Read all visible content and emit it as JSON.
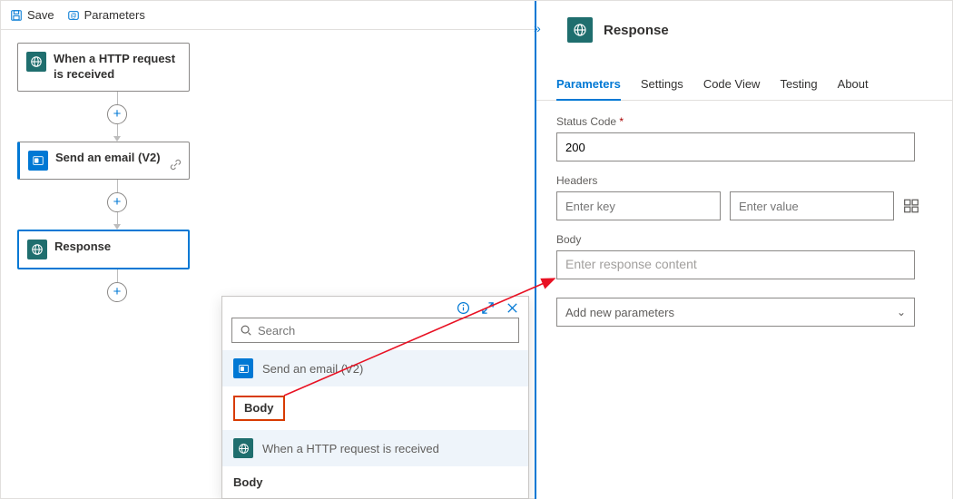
{
  "toolbar": {
    "save": "Save",
    "parameters": "Parameters"
  },
  "flow": {
    "node1": "When a HTTP request is received",
    "node2": "Send an email (V2)",
    "node3": "Response"
  },
  "picker": {
    "search_placeholder": "Search",
    "group1": "Send an email (V2)",
    "group1_item": "Body",
    "group2": "When a HTTP request is received",
    "group2_item": "Body"
  },
  "panel": {
    "title": "Response",
    "tabs": {
      "parameters": "Parameters",
      "settings": "Settings",
      "codeview": "Code View",
      "testing": "Testing",
      "about": "About"
    },
    "status_label": "Status Code",
    "status_value": "200",
    "headers_label": "Headers",
    "headers_key_placeholder": "Enter key",
    "headers_val_placeholder": "Enter value",
    "body_label": "Body",
    "body_placeholder": "Enter response content",
    "add_params": "Add new parameters"
  }
}
